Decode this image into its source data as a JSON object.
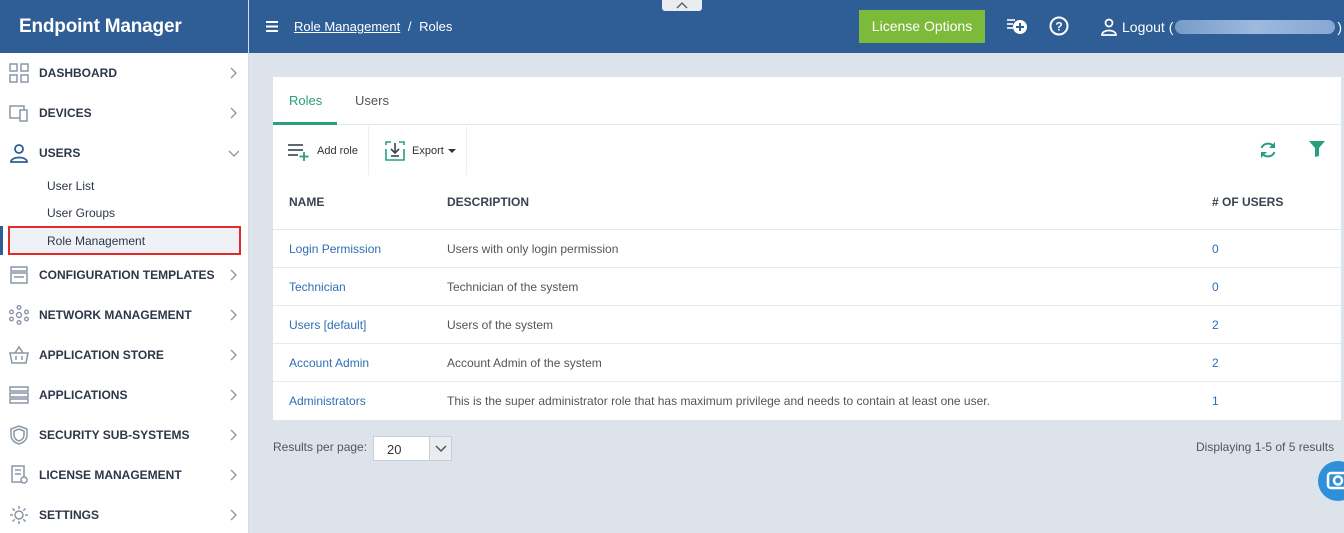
{
  "app": {
    "title": "Endpoint Manager"
  },
  "sidebar": {
    "items": [
      {
        "label": "DASHBOARD",
        "icon": "dashboard-grid-icon"
      },
      {
        "label": "DEVICES",
        "icon": "devices-icon"
      },
      {
        "label": "USERS",
        "icon": "user-icon"
      },
      {
        "label": "CONFIGURATION TEMPLATES",
        "icon": "templates-icon"
      },
      {
        "label": "NETWORK MANAGEMENT",
        "icon": "network-icon"
      },
      {
        "label": "APPLICATION STORE",
        "icon": "store-basket-icon"
      },
      {
        "label": "APPLICATIONS",
        "icon": "applications-icon"
      },
      {
        "label": "SECURITY SUB-SYSTEMS",
        "icon": "shield-icon"
      },
      {
        "label": "LICENSE MANAGEMENT",
        "icon": "license-icon"
      },
      {
        "label": "SETTINGS",
        "icon": "gear-icon"
      }
    ],
    "users_sub": [
      "User List",
      "User Groups",
      "Role Management"
    ]
  },
  "header": {
    "breadcrumb_link": "Role Management",
    "breadcrumb_sep": "/",
    "breadcrumb_current": "Roles",
    "license_button": "License Options",
    "logout_label": "Logout (",
    "logout_close": ")"
  },
  "tabs": [
    "Roles",
    "Users"
  ],
  "toolbar": {
    "add_role": "Add role",
    "export": "Export"
  },
  "table": {
    "headers": [
      "NAME",
      "DESCRIPTION",
      "# OF USERS"
    ],
    "rows": [
      {
        "name": "Login Permission",
        "description": "Users with only login permission",
        "users": "0"
      },
      {
        "name": "Technician",
        "description": "Technician of the system",
        "users": "0"
      },
      {
        "name": "Users [default]",
        "description": "Users of the system",
        "users": "2"
      },
      {
        "name": "Account Admin",
        "description": "Account Admin of the system",
        "users": "2"
      },
      {
        "name": "Administrators",
        "description": "This is the super administrator role that has maximum privilege and needs to contain at least one user.",
        "users": "1"
      }
    ]
  },
  "pager": {
    "label": "Results per page:",
    "value": "20",
    "displaying": "Displaying 1-5 of 5 results"
  },
  "colors": {
    "brand_blue": "#2f5d95",
    "accent_green": "#27a07f",
    "license_green": "#7cba3a",
    "link_blue": "#2f6fb5",
    "highlight_red": "#e02b2b"
  }
}
